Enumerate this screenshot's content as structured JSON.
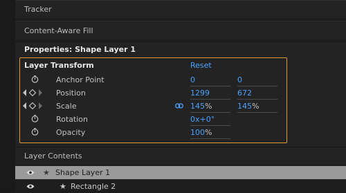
{
  "panels": {
    "tracker": "Tracker",
    "content_aware_fill": "Content-Aware Fill"
  },
  "properties": {
    "header": "Properties: Shape Layer 1",
    "section_title": "Layer Transform",
    "reset_label": "Reset",
    "rows": [
      {
        "label": "Anchor Point",
        "v1": "0",
        "v2": "0"
      },
      {
        "label": "Position",
        "v1": "1299",
        "v2": "672"
      },
      {
        "label": "Scale",
        "v1": "145",
        "v1_unit": "%",
        "v2": "145",
        "v2_unit": "%"
      },
      {
        "label": "Rotation",
        "v1": "0x+0°"
      },
      {
        "label": "Opacity",
        "v1": "100",
        "v1_unit": "%"
      }
    ]
  },
  "layer_contents": {
    "title": "Layer Contents",
    "items": [
      {
        "label": "Shape Layer 1"
      },
      {
        "label": "Rectangle 2"
      }
    ]
  },
  "colors": {
    "accent_blue": "#4aa3ff",
    "highlight_orange": "#e19a2c"
  }
}
